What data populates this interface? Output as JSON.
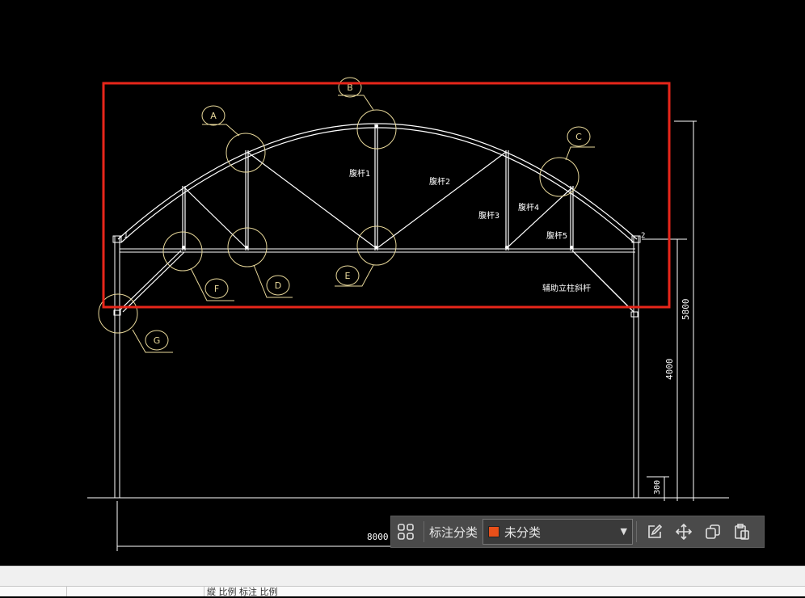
{
  "drawing": {
    "callouts": [
      "A",
      "B",
      "C",
      "D",
      "E",
      "F",
      "G"
    ],
    "member_labels": {
      "web1": "腹杆1",
      "web2": "腹杆2",
      "web3": "腹杆3",
      "web4": "腹杆4",
      "web5": "腹杆5",
      "side_brace": "辅助立柱斜杆"
    },
    "dimensions": {
      "span": "8000",
      "total_height": "5800",
      "column_height": "4000",
      "base": "300"
    },
    "highlight_color": "#e8261a",
    "callout_color": "#e8d89a",
    "line_color": "#ffffff"
  },
  "toolbar": {
    "classify_label": "标注分类",
    "category_value": "未分类",
    "category_color": "#e8501a"
  },
  "statusbar": {
    "text": "縱 比例 标注 比例"
  }
}
